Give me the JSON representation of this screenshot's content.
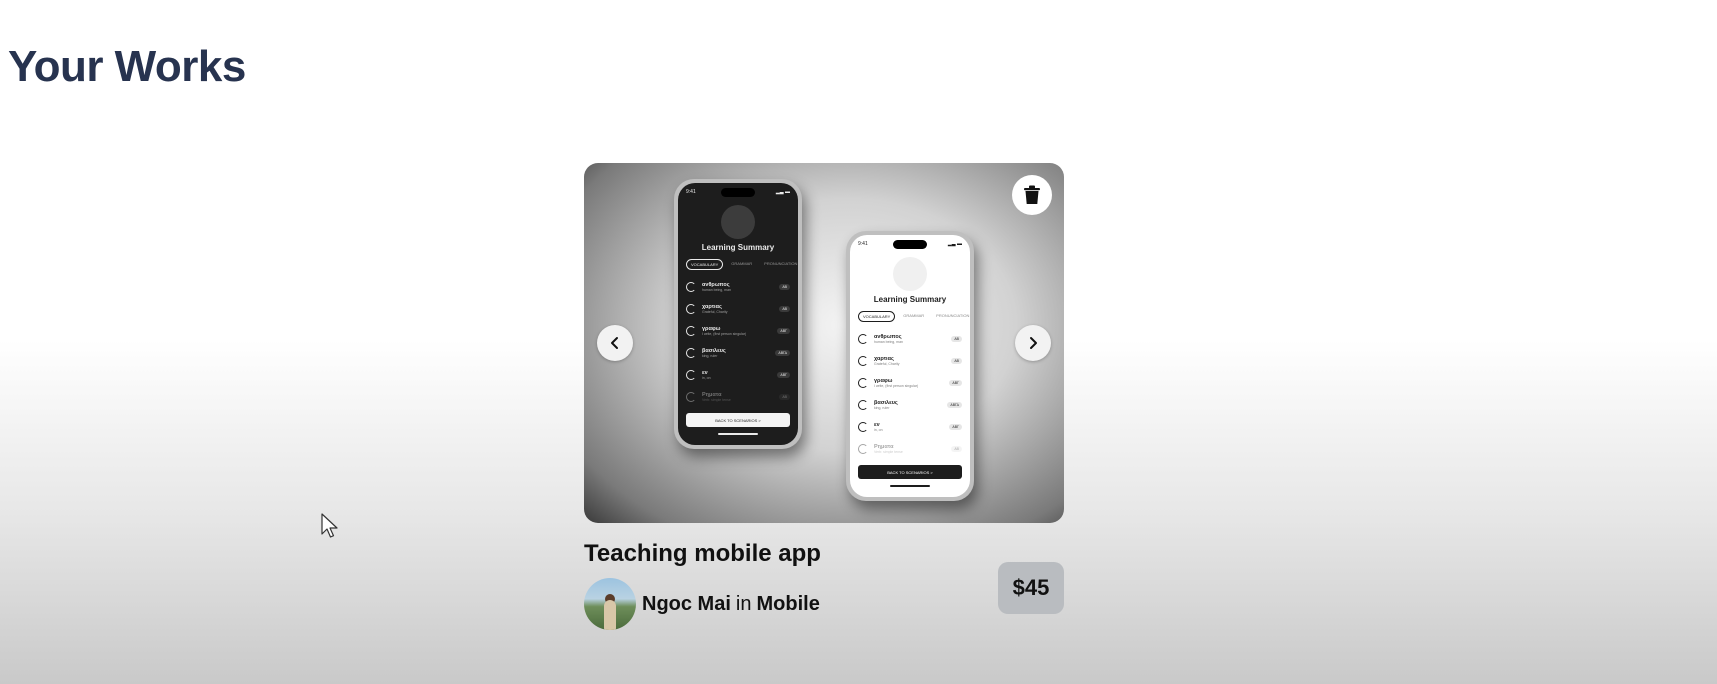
{
  "page": {
    "title": "Your Works"
  },
  "work": {
    "title": "Teaching mobile app",
    "author": "Ngoc Mai",
    "in_word": "in",
    "category": "Mobile",
    "price": "$45"
  },
  "icons": {
    "prev": "chevron-left-icon",
    "next": "chevron-right-icon",
    "delete": "trash-icon"
  },
  "mockup": {
    "status_time": "9:41",
    "screen_title": "Learning Summary",
    "tabs": [
      "VOCABULARY",
      "GRAMMAR",
      "PRONUNCIATION"
    ],
    "rows": [
      {
        "word": "ανθρωπος",
        "sub": "human being, man",
        "badge": "ΑΒ"
      },
      {
        "word": "χαρτιας",
        "sub": "Grateful, Charity",
        "badge": "ΑΒ"
      },
      {
        "word": "γραφω",
        "sub": "I write, (first person singular)",
        "badge": "ΑΒΓ"
      },
      {
        "word": "βασιλευς",
        "sub": "king, ruler",
        "badge": "ΑΒΓΔ"
      },
      {
        "word": "εν",
        "sub": "in, on",
        "badge": "ΑΒΓ"
      },
      {
        "word": "Ρηματα",
        "sub": "Verb: simple tense",
        "badge": "ΑΒ"
      }
    ],
    "back_button": "BACK TO SCENARIOS >"
  },
  "colors": {
    "title": "#27334f",
    "price_bg": "#b9bcc0"
  }
}
